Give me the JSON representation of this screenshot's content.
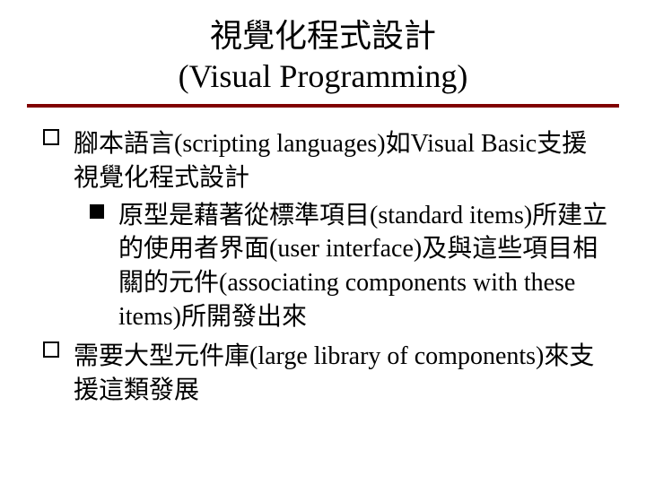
{
  "title_line1": "視覺化程式設計",
  "title_line2": "(Visual Programming)",
  "items": [
    {
      "text": "腳本語言(scripting languages)如Visual Basic支援視覺化程式設計",
      "sub": [
        {
          "text": "原型是藉著從標準項目(standard items)所建立的使用者界面(user interface)及與這些項目相關的元件(associating components with these items)所開發出來"
        }
      ]
    },
    {
      "text": "需要大型元件庫(large library of components)來支援這類發展",
      "sub": []
    }
  ]
}
